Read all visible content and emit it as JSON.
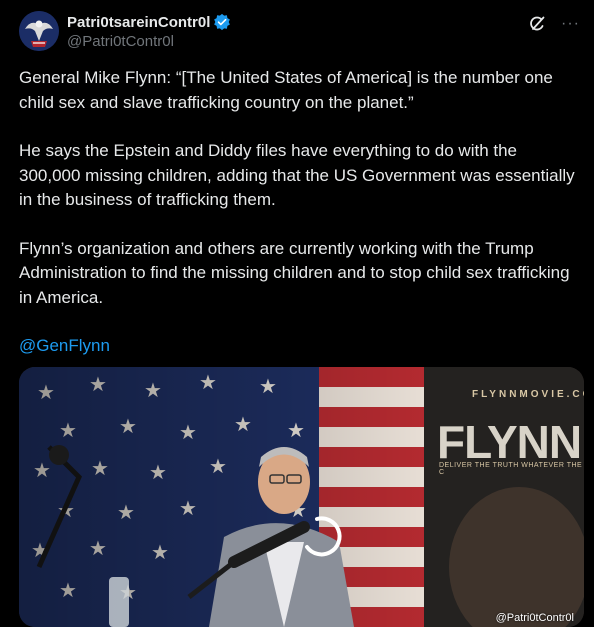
{
  "author": {
    "display_name": "Patri0tsareinContr0l",
    "handle": "@Patri0tContr0l",
    "avatar_icon": "eagle-avatar-icon",
    "verified_icon": "verified-badge-icon"
  },
  "actions": {
    "grok_icon": "grok-icon",
    "more_label": "···"
  },
  "tweet": {
    "paragraphs": [
      "General Mike Flynn: “[The United States of America] is the number one child sex and slave trafficking country on the planet.”",
      "He says the Epstein and Diddy files have everything to do with the 300,000 missing children, adding that the US Government was essentially in the business of trafficking them.",
      "Flynn’s organization and others are currently working with the Trump Administration to find the missing children and to stop child sex trafficking in America."
    ],
    "mention": "@GenFlynn"
  },
  "media": {
    "poster_site": "FLYNNMOVIE.CO",
    "poster_title": "FLYNN",
    "poster_tagline": "DELIVER THE TRUTH WHATEVER THE C",
    "watermark": "@Patri0tContr0l"
  },
  "colors": {
    "background": "#000000",
    "text": "#e7e9ea",
    "secondary": "#71767b",
    "link": "#1d9bf0",
    "verified": "#1d9bf0"
  }
}
